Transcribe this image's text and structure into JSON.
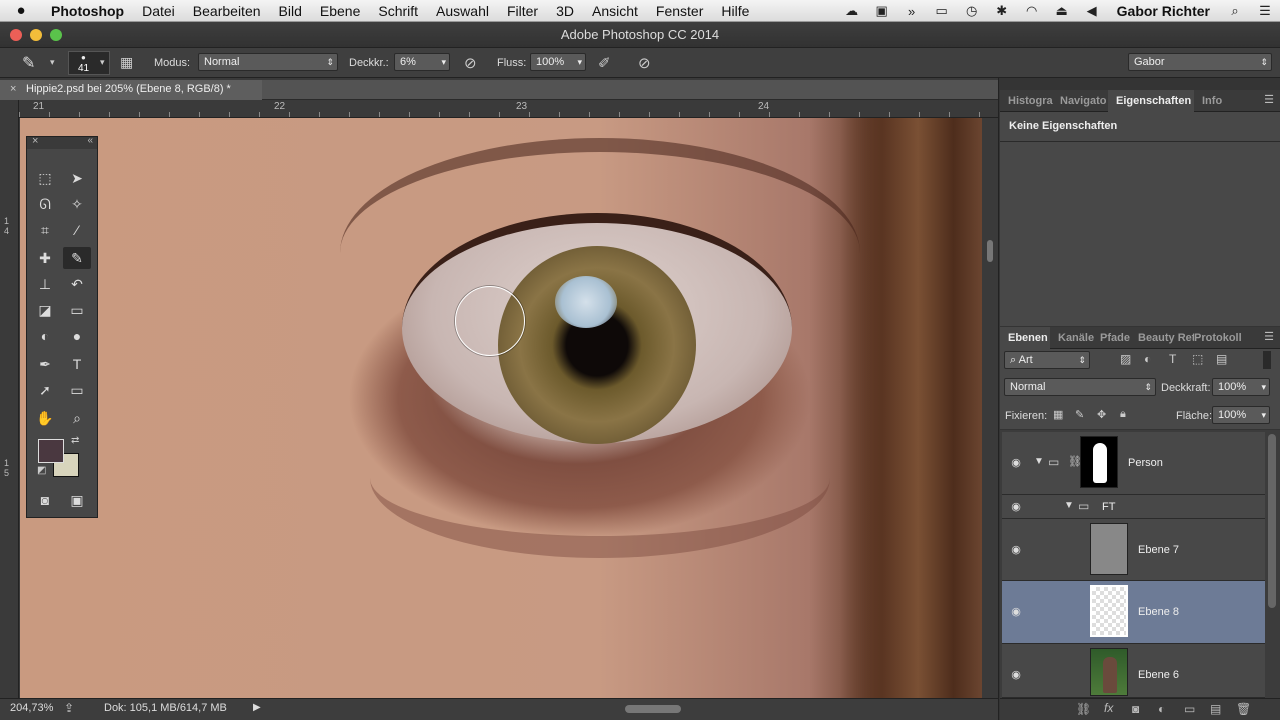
{
  "menubar": {
    "apple": "",
    "items": [
      "Photoshop",
      "Datei",
      "Bearbeiten",
      "Bild",
      "Ebene",
      "Schrift",
      "Auswahl",
      "Filter",
      "3D",
      "Ansicht",
      "Fenster",
      "Hilfe"
    ],
    "user": "Gabor Richter"
  },
  "titlebar": {
    "title": "Adobe Photoshop CC 2014"
  },
  "options": {
    "brush_size": "41",
    "modus_label": "Modus:",
    "modus_value": "Normal",
    "deckkr_label": "Deckkr.:",
    "deckkr_value": "6%",
    "fluss_label": "Fluss:",
    "fluss_value": "100%",
    "workspace": "Gabor"
  },
  "document": {
    "tab_title": "Hippie2.psd bei 205% (Ebene 8, RGB/8) *",
    "ruler_h": [
      "21",
      "22",
      "23",
      "24"
    ],
    "ruler_v": [
      "1\n4",
      "1\n5"
    ]
  },
  "status": {
    "zoom": "204,73%",
    "doc": "Dok: 105,1 MB/614,7 MB"
  },
  "properties_panel": {
    "tabs": [
      "Histogra",
      "Navigato",
      "Eigenschaften",
      "Info"
    ],
    "active_tab": "Eigenschaften",
    "content": "Keine Eigenschaften"
  },
  "layers_panel": {
    "tabs": [
      "Ebenen",
      "Kanäle",
      "Pfade",
      "Beauty Ret",
      "Protokoll"
    ],
    "filter_value": "Art",
    "blend_mode": "Normal",
    "opacity_label": "Deckkraft:",
    "opacity_value": "100%",
    "lock_label": "Fixieren:",
    "fill_label": "Fläche:",
    "fill_value": "100%",
    "layers": [
      {
        "name": "Person",
        "type": "group-mask"
      },
      {
        "name": "FT",
        "type": "group"
      },
      {
        "name": "Ebene 7",
        "type": "layer"
      },
      {
        "name": "Ebene 8",
        "type": "layer",
        "selected": true
      },
      {
        "name": "Ebene 6",
        "type": "layer"
      }
    ]
  },
  "colors": {
    "foreground": "#4a3840",
    "background": "#d8d4bc",
    "selection": "#6d7b96"
  }
}
